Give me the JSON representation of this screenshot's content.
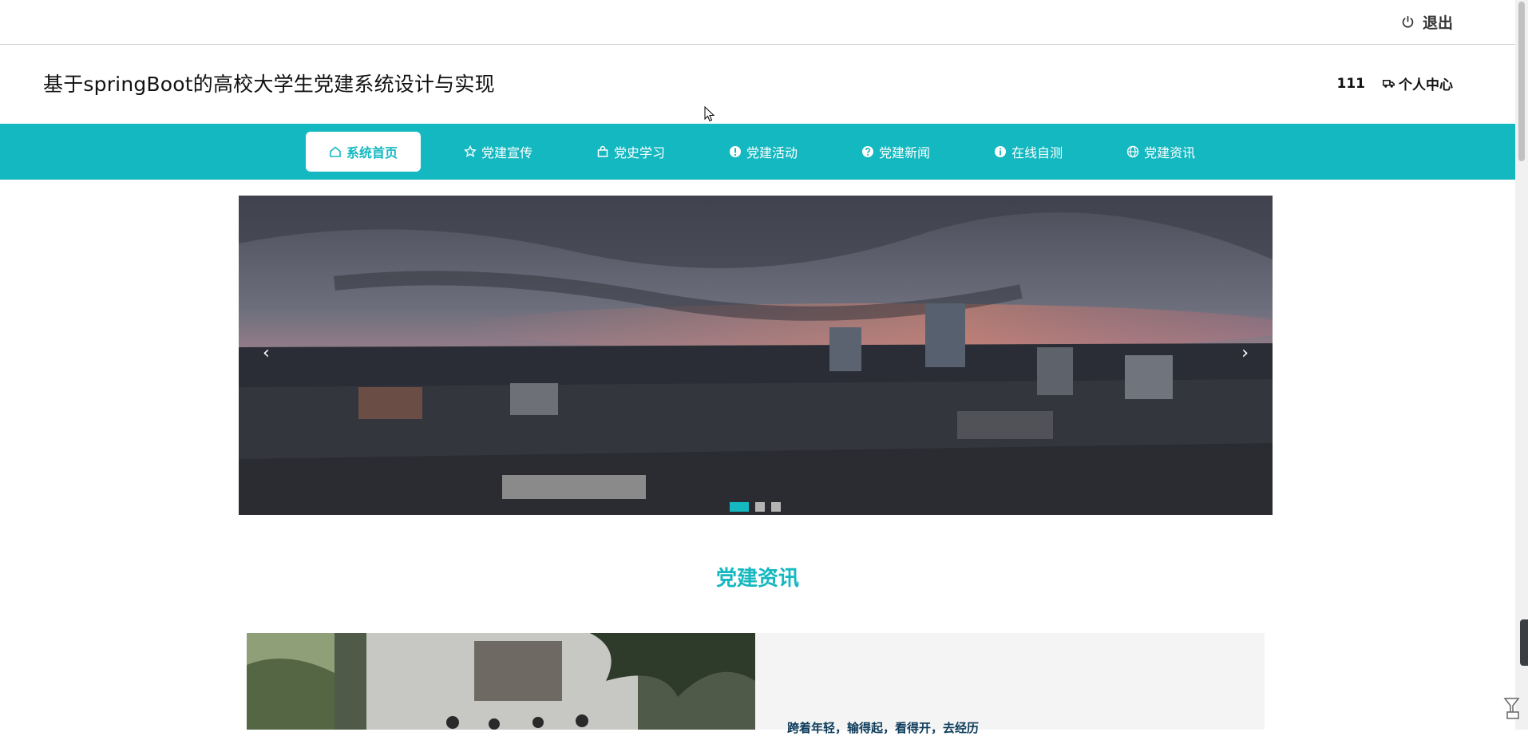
{
  "topbar": {
    "logout_label": "退出"
  },
  "header": {
    "site_title": "基于springBoot的高校大学生党建系统设计与实现",
    "username": "111",
    "profile_label": "个人中心"
  },
  "nav": {
    "items": [
      {
        "label": "系统首页",
        "icon": "home-icon"
      },
      {
        "label": "党建宣传",
        "icon": "star-icon"
      },
      {
        "label": "党史学习",
        "icon": "bag-icon"
      },
      {
        "label": "党建活动",
        "icon": "alert-icon"
      },
      {
        "label": "党建新闻",
        "icon": "help-icon"
      },
      {
        "label": "在线自测",
        "icon": "info-icon"
      },
      {
        "label": "党建资讯",
        "icon": "globe-icon"
      }
    ],
    "active_index": 0
  },
  "carousel": {
    "prev_glyph": "‹",
    "next_glyph": "›",
    "slide_count": 3,
    "active_slide": 0
  },
  "section": {
    "title": "党建资讯"
  },
  "news": {
    "headline": "跨着年轻，输得起，看得开，去经历"
  },
  "colors": {
    "accent": "#14b8c0",
    "headline": "#0c3b5a"
  }
}
